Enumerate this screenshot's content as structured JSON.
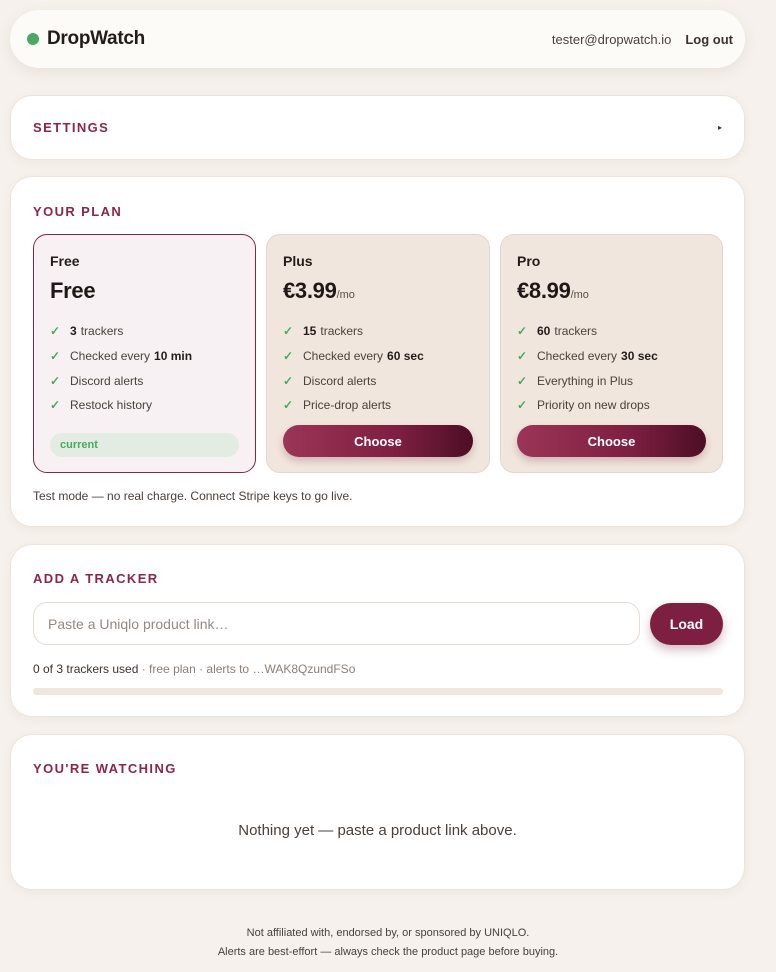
{
  "header": {
    "brand": "DropWatch",
    "user_email": "tester@dropwatch.io",
    "logout_label": "Log out",
    "status_dot_color": "#4aa862"
  },
  "settings": {
    "title": "SETTINGS",
    "toggle_icon": "caret-right-icon"
  },
  "plan": {
    "title": "YOUR PLAN",
    "note": "Test mode — no real charge. Connect Stripe keys to go live.",
    "tiers": [
      {
        "name": "Free",
        "price": "Free",
        "period": "",
        "current": true,
        "badge": "current",
        "features": [
          {
            "pre": "",
            "bold": "3",
            "post": "trackers"
          },
          {
            "pre": "Checked every",
            "bold": "10 min",
            "post": ""
          },
          {
            "pre": "Discord alerts",
            "bold": "",
            "post": ""
          },
          {
            "pre": "Restock history",
            "bold": "",
            "post": ""
          }
        ]
      },
      {
        "name": "Plus",
        "price": "€3.99",
        "period": "/mo",
        "current": false,
        "button": "Choose",
        "features": [
          {
            "pre": "",
            "bold": "15",
            "post": "trackers"
          },
          {
            "pre": "Checked every",
            "bold": "60 sec",
            "post": ""
          },
          {
            "pre": "Discord alerts",
            "bold": "",
            "post": ""
          },
          {
            "pre": "Price-drop alerts",
            "bold": "",
            "post": ""
          }
        ]
      },
      {
        "name": "Pro",
        "price": "€8.99",
        "period": "/mo",
        "current": false,
        "button": "Choose",
        "features": [
          {
            "pre": "",
            "bold": "60",
            "post": "trackers"
          },
          {
            "pre": "Checked every",
            "bold": "30 sec",
            "post": ""
          },
          {
            "pre": "Everything in Plus",
            "bold": "",
            "post": ""
          },
          {
            "pre": "Priority on new drops",
            "bold": "",
            "post": ""
          }
        ]
      }
    ]
  },
  "tracker": {
    "title": "ADD A TRACKER",
    "input_placeholder": "Paste a Uniqlo product link…",
    "input_value": "",
    "load_label": "Load",
    "usage_main": "0 of 3 trackers used",
    "usage_meta": " · free plan · alerts to …WAK8QzundFSo",
    "usage_fraction": 0
  },
  "watching": {
    "title": "YOU'RE WATCHING",
    "empty_text": "Nothing yet — paste a product link above."
  },
  "footer": {
    "line1": "Not affiliated with, endorsed by, or sponsored by UNIQLO.",
    "line2": "Alerts are best-effort — always check the product page before buying."
  },
  "colors": {
    "accent": "#8a2748",
    "success": "#4aa862",
    "background": "#f6f1ec"
  }
}
